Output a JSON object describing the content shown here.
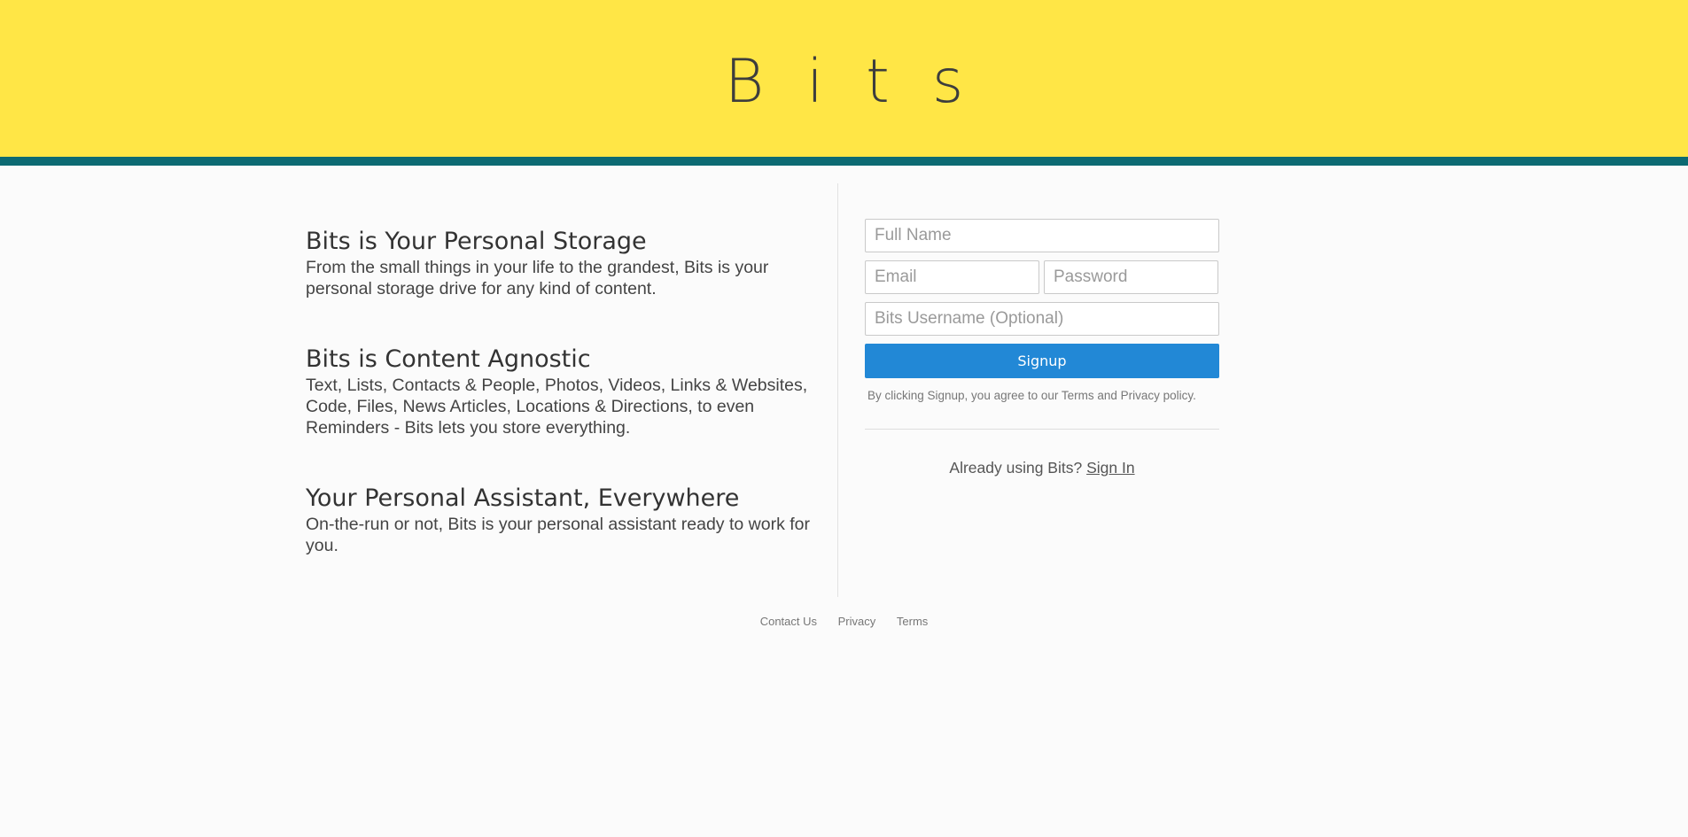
{
  "header": {
    "logo": "Bits",
    "colors": {
      "background": "#ffe646",
      "bar": "#0c6a72"
    }
  },
  "features": [
    {
      "title": "Bits is Your Personal Storage",
      "description": "From the small things in your life to the grandest, Bits is your personal storage drive for any kind of content."
    },
    {
      "title": "Bits is Content Agnostic",
      "description": "Text, Lists, Contacts & People, Photos, Videos, Links & Websites, Code, Files, News Articles, Locations & Directions, to even Reminders - Bits lets you store everything."
    },
    {
      "title": "Your Personal Assistant, Everywhere",
      "description": "On-the-run or not, Bits is your personal assistant ready to work for you."
    }
  ],
  "signup": {
    "fullname_placeholder": "Full Name",
    "email_placeholder": "Email",
    "password_placeholder": "Password",
    "username_placeholder": "Bits Username (Optional)",
    "button_label": "Signup",
    "button_color": "#2288d6",
    "legal": "By clicking Signup, you agree to our Terms and Privacy policy.",
    "signin_prompt": "Already using Bits?",
    "signin_link": "Sign In"
  },
  "footer": {
    "links": [
      "Contact Us",
      "Privacy",
      "Terms"
    ]
  }
}
